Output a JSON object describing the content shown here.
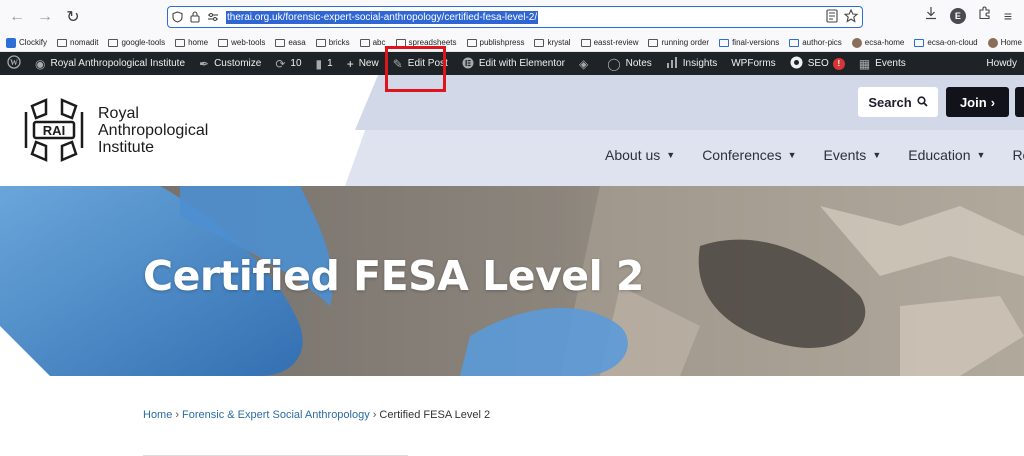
{
  "browser": {
    "url": "therai.org.uk/forensic-expert-social-anthropology/certified-fesa-level-2/",
    "avatar_letter": "E"
  },
  "bookmarks": [
    {
      "label": "Clockify",
      "kind": "app"
    },
    {
      "label": "nomadit",
      "kind": "folder"
    },
    {
      "label": "google-tools",
      "kind": "folder"
    },
    {
      "label": "home",
      "kind": "folder"
    },
    {
      "label": "web-tools",
      "kind": "folder"
    },
    {
      "label": "easa",
      "kind": "folder"
    },
    {
      "label": "bricks",
      "kind": "folder"
    },
    {
      "label": "abc",
      "kind": "folder"
    },
    {
      "label": "spreadsheets",
      "kind": "folder"
    },
    {
      "label": "publishpress",
      "kind": "folder"
    },
    {
      "label": "krystal",
      "kind": "folder"
    },
    {
      "label": "easst-review",
      "kind": "folder"
    },
    {
      "label": "running order",
      "kind": "folder"
    },
    {
      "label": "final-versions",
      "kind": "folder"
    },
    {
      "label": "author-pics",
      "kind": "folder"
    },
    {
      "label": "ecsa-home",
      "kind": "site"
    },
    {
      "label": "ecsa-on-cloud",
      "kind": "folder"
    },
    {
      "label": "Home - ECSA Confer...",
      "kind": "site"
    }
  ],
  "adminbar": {
    "site_name": "Royal Anthropological Institute",
    "customize": "Customize",
    "updates_count": "10",
    "comments_count": "1",
    "new": "New",
    "edit_post": "Edit Post",
    "edit_elementor": "Edit with Elementor",
    "notes": "Notes",
    "insights": "Insights",
    "wpforms": "WPForms",
    "seo": "SEO",
    "seo_badge": "!",
    "events": "Events",
    "howdy": "Howdy"
  },
  "site": {
    "logo_abbr": "RAI",
    "logo_line1": "Royal",
    "logo_line2": "Anthropological",
    "logo_line3": "Institute",
    "search_label": "Search",
    "join_label": "Join",
    "nav": [
      "About us",
      "Conferences",
      "Events",
      "Education",
      "Res"
    ]
  },
  "hero": {
    "title": "Certified FESA Level 2"
  },
  "breadcrumb": {
    "home": "Home",
    "section": "Forensic & Expert Social Anthropology",
    "current": "Certified FESA Level 2",
    "sep": "›"
  },
  "colors": {
    "admin_bg": "#1d2327",
    "highlight": "#e0151b",
    "link": "#2b6ca8",
    "header_band": "#dfe3ef"
  }
}
